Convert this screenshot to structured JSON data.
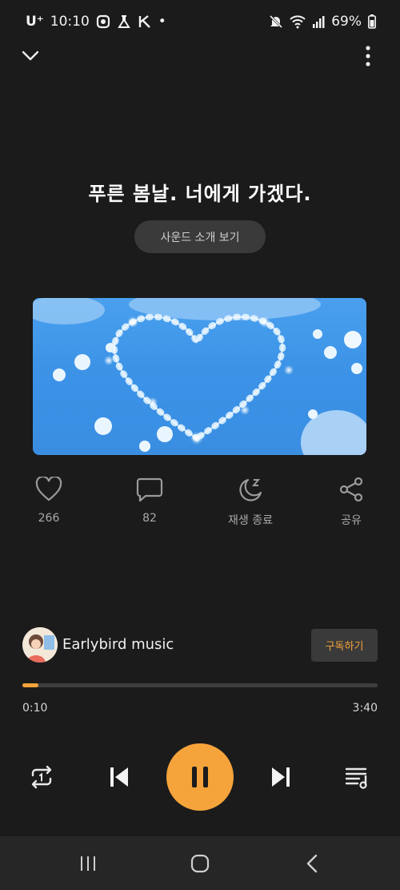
{
  "status_bar": {
    "carrier": "U⁺",
    "time": "10:10",
    "dot": "•",
    "battery": "69%",
    "icons": [
      "app-icon",
      "flask-icon",
      "k-icon",
      "mute-icon",
      "wifi-icon",
      "signal-icon",
      "battery-icon"
    ]
  },
  "header": {
    "collapse_icon": "chevron-down-icon",
    "more_icon": "more-vertical-icon"
  },
  "track": {
    "title": "푸른 봄날. 너에게 가겠다.",
    "intro_button": "사운드 소개 보기"
  },
  "artwork": {
    "description_icon": "heart-bubbles-image"
  },
  "actions": [
    {
      "icon": "heart-icon",
      "label": "266"
    },
    {
      "icon": "comment-icon",
      "label": "82"
    },
    {
      "icon": "sleep-timer-icon",
      "label": "재생 종료"
    },
    {
      "icon": "share-icon",
      "label": "공유"
    }
  ],
  "artist": {
    "name": "Earlybird music",
    "subscribe_label": "구독하기"
  },
  "progress": {
    "current": "0:10",
    "duration": "3:40",
    "fraction": 0.045
  },
  "controls": {
    "repeat_icon": "repeat-one-icon",
    "prev_icon": "skip-previous-icon",
    "play_icon": "pause-icon",
    "next_icon": "skip-next-icon",
    "queue_icon": "queue-music-icon"
  },
  "nav": {
    "icons": [
      "recent-apps-icon",
      "home-icon",
      "back-icon"
    ]
  },
  "colors": {
    "accent": "#f5a33b",
    "background": "#1b1b1b"
  }
}
